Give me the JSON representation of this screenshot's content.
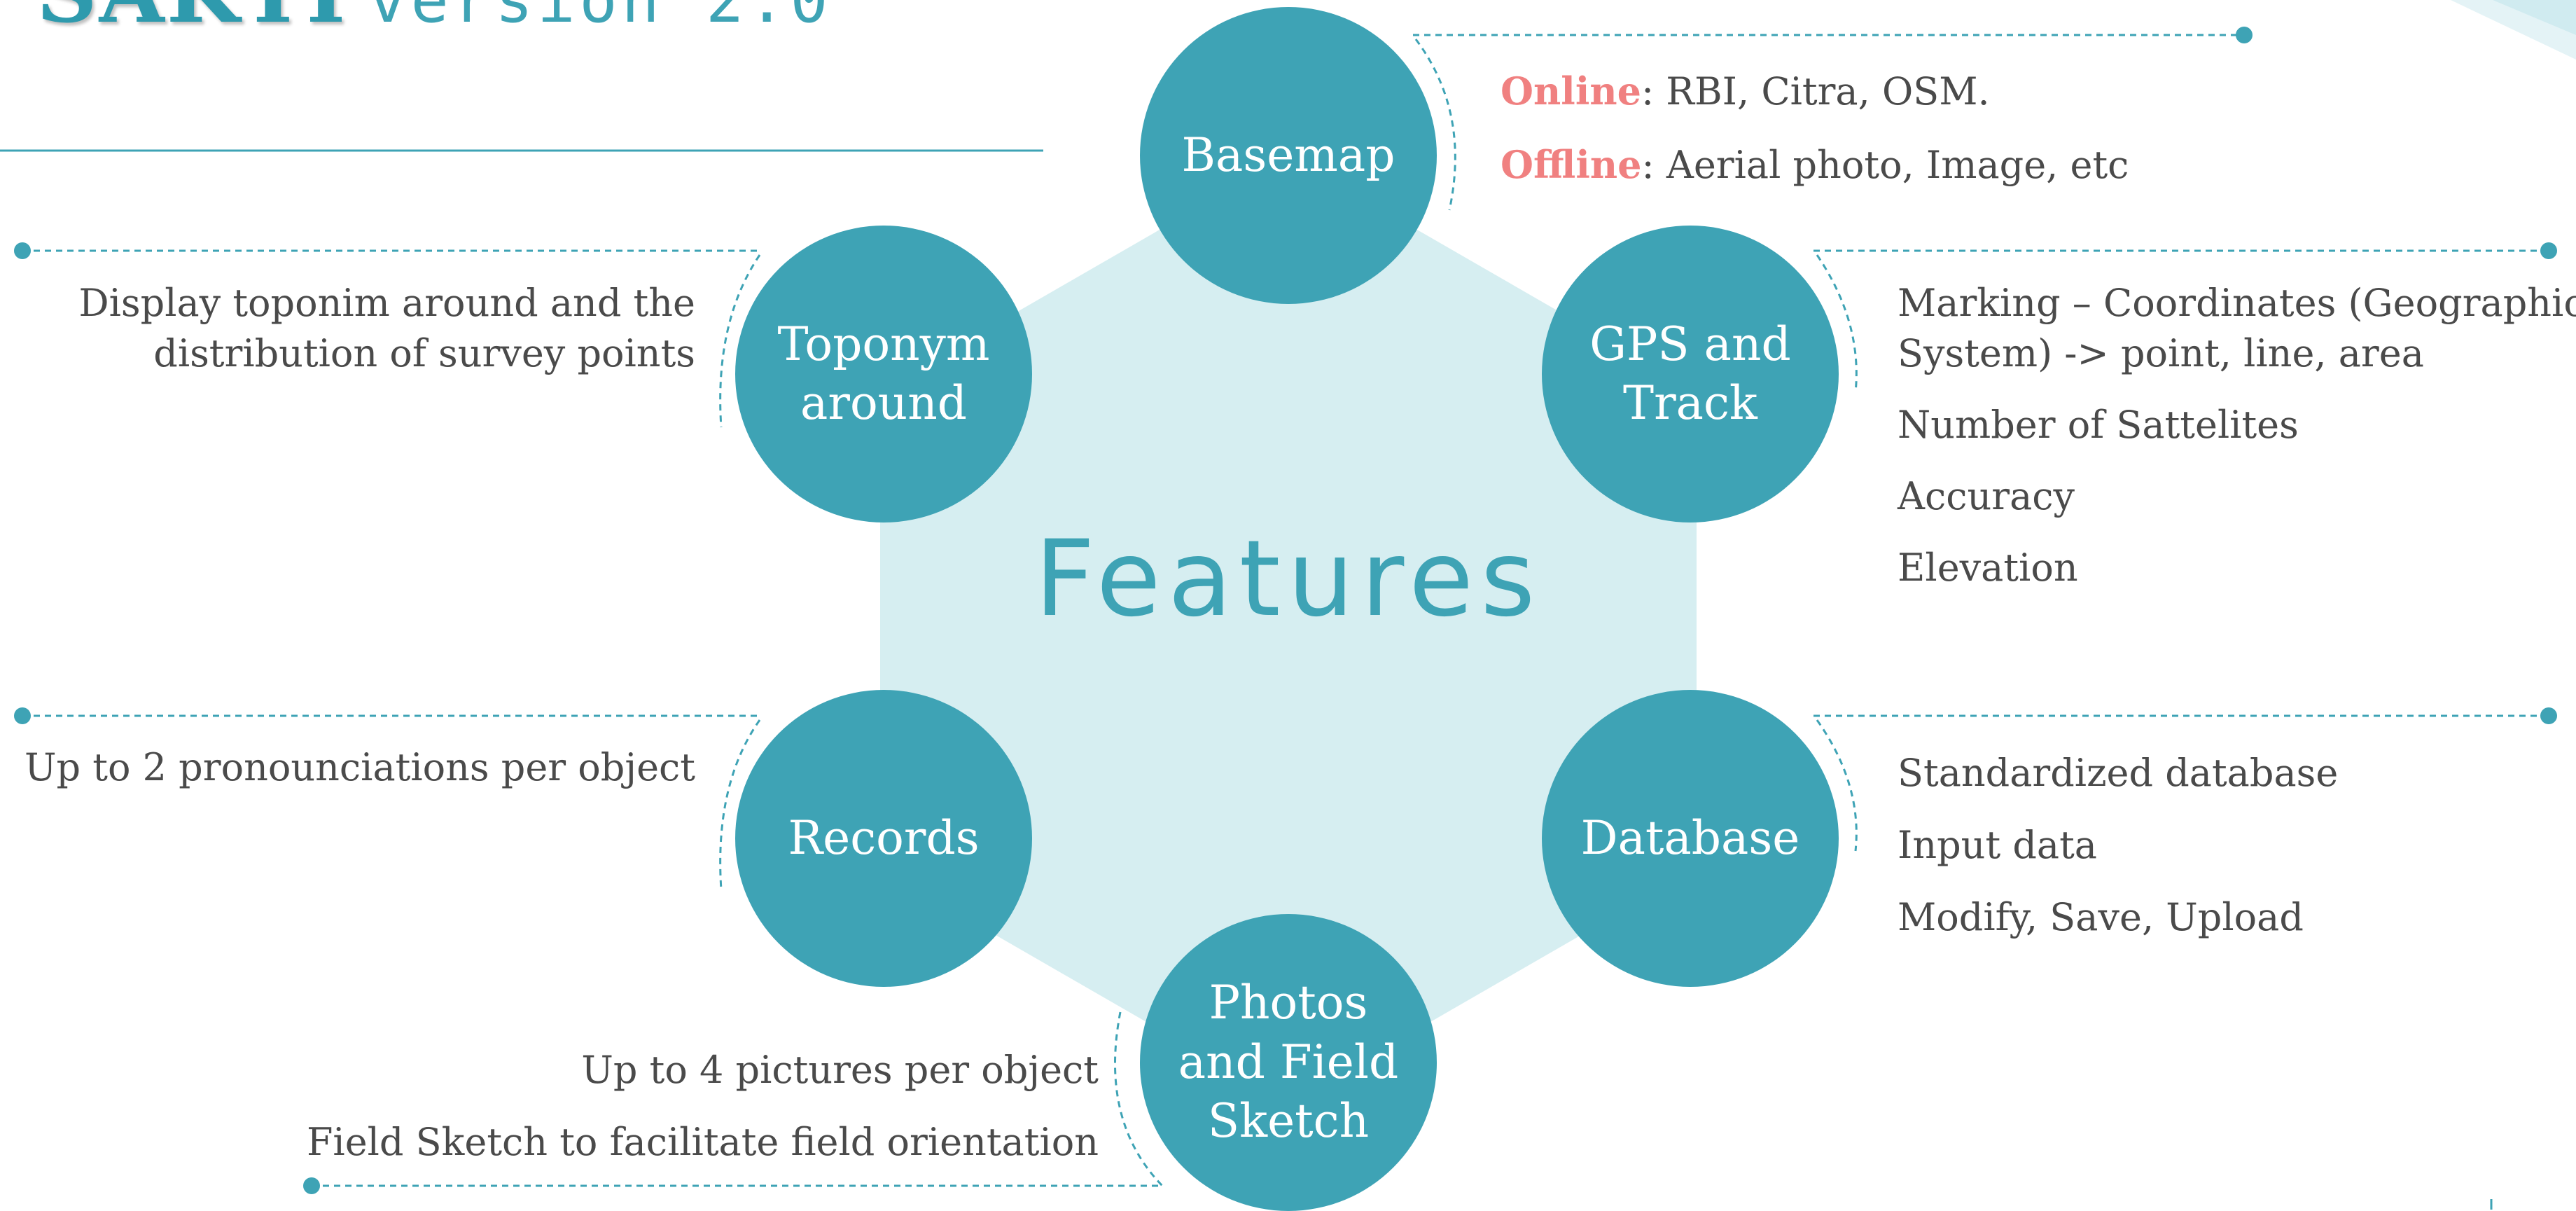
{
  "header": {
    "app_name": "SAKTI",
    "version": "version 2.0"
  },
  "center": {
    "title": "Features"
  },
  "features": {
    "basemap": {
      "label": "Basemap"
    },
    "gps": {
      "label": "GPS and\nTrack"
    },
    "database": {
      "label": "Database"
    },
    "photos": {
      "label": "Photos\nand Field\nSketch"
    },
    "records": {
      "label": "Records"
    },
    "toponym": {
      "label": "Toponym\naround"
    }
  },
  "descriptions": {
    "basemap": {
      "online_key": "Online",
      "online_value": ": RBI, Citra, OSM.",
      "offline_key": "Offline",
      "offline_value": ": Aerial photo, Image, etc"
    },
    "gps": {
      "line1": "Marking – Coordinates (Geographic",
      "line2": "System) -> point, line, area",
      "line3": "Number of Sattelites",
      "line4": "Accuracy",
      "line5": "Elevation"
    },
    "database": {
      "line1": "Standardized database",
      "line2": "Input data",
      "line3": "Modify, Save, Upload"
    },
    "photos": {
      "line1": "Up to 4 pictures per object",
      "line2": "Field Sketch to facilitate field orientation"
    },
    "records": {
      "line1": "Up to 2 pronounciations per object"
    },
    "toponym": {
      "line1": "Display toponim around and the",
      "line2": "distribution of survey points"
    }
  },
  "colors": {
    "accent": "#3ea3b5",
    "hexagon": "#d6eef1",
    "highlight": "#f08080",
    "text": "#4a4a4a"
  }
}
